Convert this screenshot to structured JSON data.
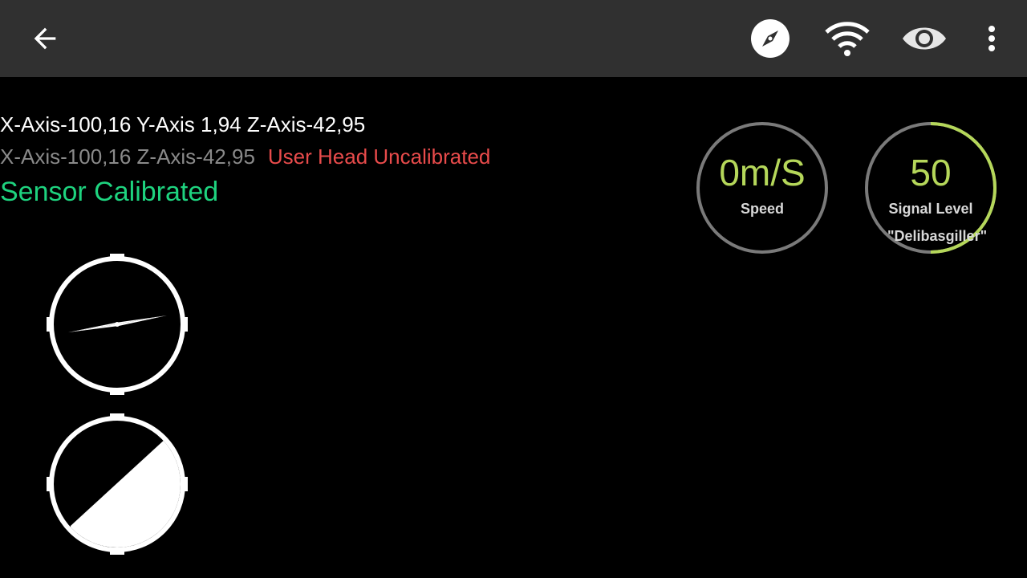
{
  "appbar": {
    "icons": [
      "back-arrow-icon",
      "compass-icon",
      "wifi-icon",
      "eye-icon",
      "more-vert-icon"
    ]
  },
  "axes": {
    "line1": "X-Axis-100,16 Y-Axis 1,94 Z-Axis-42,95",
    "line2": "X-Axis-100,16 Z-Axis-42,95",
    "head_status": "User Head Uncalibrated",
    "sensor_status": "Sensor Calibrated"
  },
  "speed_gauge": {
    "value": "0m/S",
    "label": "Speed"
  },
  "signal_gauge": {
    "value": "50",
    "label": "Signal Level",
    "network": "\"Delibasgiller\"",
    "level_fraction": 0.5
  },
  "colors": {
    "appbar": "#303030",
    "background": "#000000",
    "gauge_value": "#b5d75a",
    "signal_arc": "#b5d75a",
    "head_status": "#e84b4b",
    "sensor_status": "#1ed37f",
    "muted_text": "#8a8a8a"
  }
}
